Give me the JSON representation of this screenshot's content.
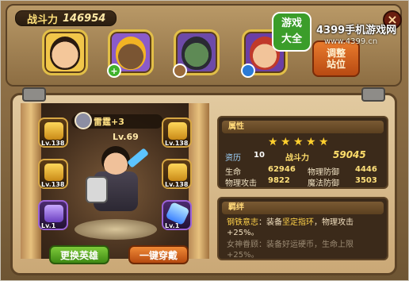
{
  "power": {
    "label": "战斗力",
    "value": "146954"
  },
  "team": [
    {
      "name": "team-hero-1",
      "badge": ""
    },
    {
      "name": "team-hero-2",
      "badge": "+"
    },
    {
      "name": "team-hero-3",
      "badge": ""
    },
    {
      "name": "team-hero-4",
      "badge": ""
    }
  ],
  "adjust_button": {
    "line1": "调整",
    "line2": "站位"
  },
  "close_label": "×",
  "watermark": {
    "logo_line1": "游戏",
    "logo_line2": "大全",
    "name": "4399手机游戏网",
    "url": "www.4399.cn"
  },
  "hero": {
    "name": "雷霆+3",
    "level": "Lv.69"
  },
  "equipment": [
    {
      "slot": "weapon",
      "level": "Lv.138",
      "icon": "gold-weapon-icon"
    },
    {
      "slot": "helmet",
      "level": "Lv.138",
      "icon": "gold-helmet-icon"
    },
    {
      "slot": "armor",
      "level": "Lv.138",
      "icon": "gold-armor-icon"
    },
    {
      "slot": "boots",
      "level": "Lv.138",
      "icon": "gold-boots-icon"
    },
    {
      "slot": "ring",
      "level": "Lv.1",
      "icon": "purple-ring-icon"
    },
    {
      "slot": "gem",
      "level": "Lv.1",
      "icon": "crystal-icon"
    }
  ],
  "buttons": {
    "switch_hero": "更换英雄",
    "equip_all": "一键穿戴"
  },
  "attributes": {
    "title": "属性",
    "stars": 5,
    "qualification_label": "资历",
    "qualification_value": "10",
    "combat_label": "战斗力",
    "combat_value": "59045",
    "hp_label": "生命",
    "hp": "62946",
    "pdef_label": "物理防御",
    "pdef": "4446",
    "patk_label": "物理攻击",
    "patk": "9822",
    "mdef_label": "魔法防御",
    "mdef": "3503"
  },
  "bonds": {
    "title": "羁绊",
    "bond1_name": "钢铁意志",
    "bond1_pre": "：装备",
    "bond1_item": "坚定指环",
    "bond1_post": "，物理攻击+25%。",
    "bond2_name": "女神眷顾",
    "bond2_text": "：装备好运硬币，生命上限+25%。"
  },
  "colors": {
    "accent_gold": "#ffd879",
    "frame_brown": "#5c4326"
  }
}
